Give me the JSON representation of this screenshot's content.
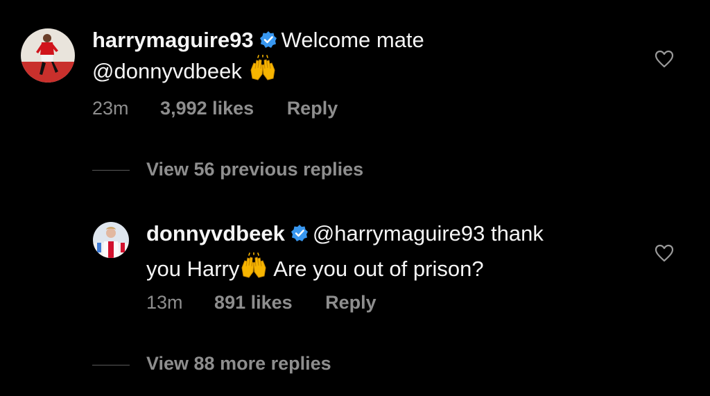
{
  "comments": [
    {
      "username": "harrymaguire93",
      "text_part1": "Welcome mate",
      "text_part2": "@donnyvdbeek",
      "time": "23m",
      "likes": "3,992 likes",
      "reply": "Reply",
      "avatar_icon": "player-avatar",
      "emoji": "raising-hands-emoji"
    },
    {
      "username": "donnyvdbeek",
      "mention": "@harrymaguire93",
      "text_part1": "thank",
      "text_part2": "you Harry",
      "text_part3": "Are you out of prison?",
      "time": "13m",
      "likes": "891 likes",
      "reply": "Reply",
      "avatar_icon": "player-avatar",
      "emoji": "raising-hands-emoji"
    }
  ],
  "view_previous_replies": "View 56 previous replies",
  "view_more_replies": "View 88 more replies",
  "colors": {
    "background": "#000000",
    "text": "#f5f5f5",
    "secondary": "#8e8e8e",
    "verified": "#3897f0"
  }
}
